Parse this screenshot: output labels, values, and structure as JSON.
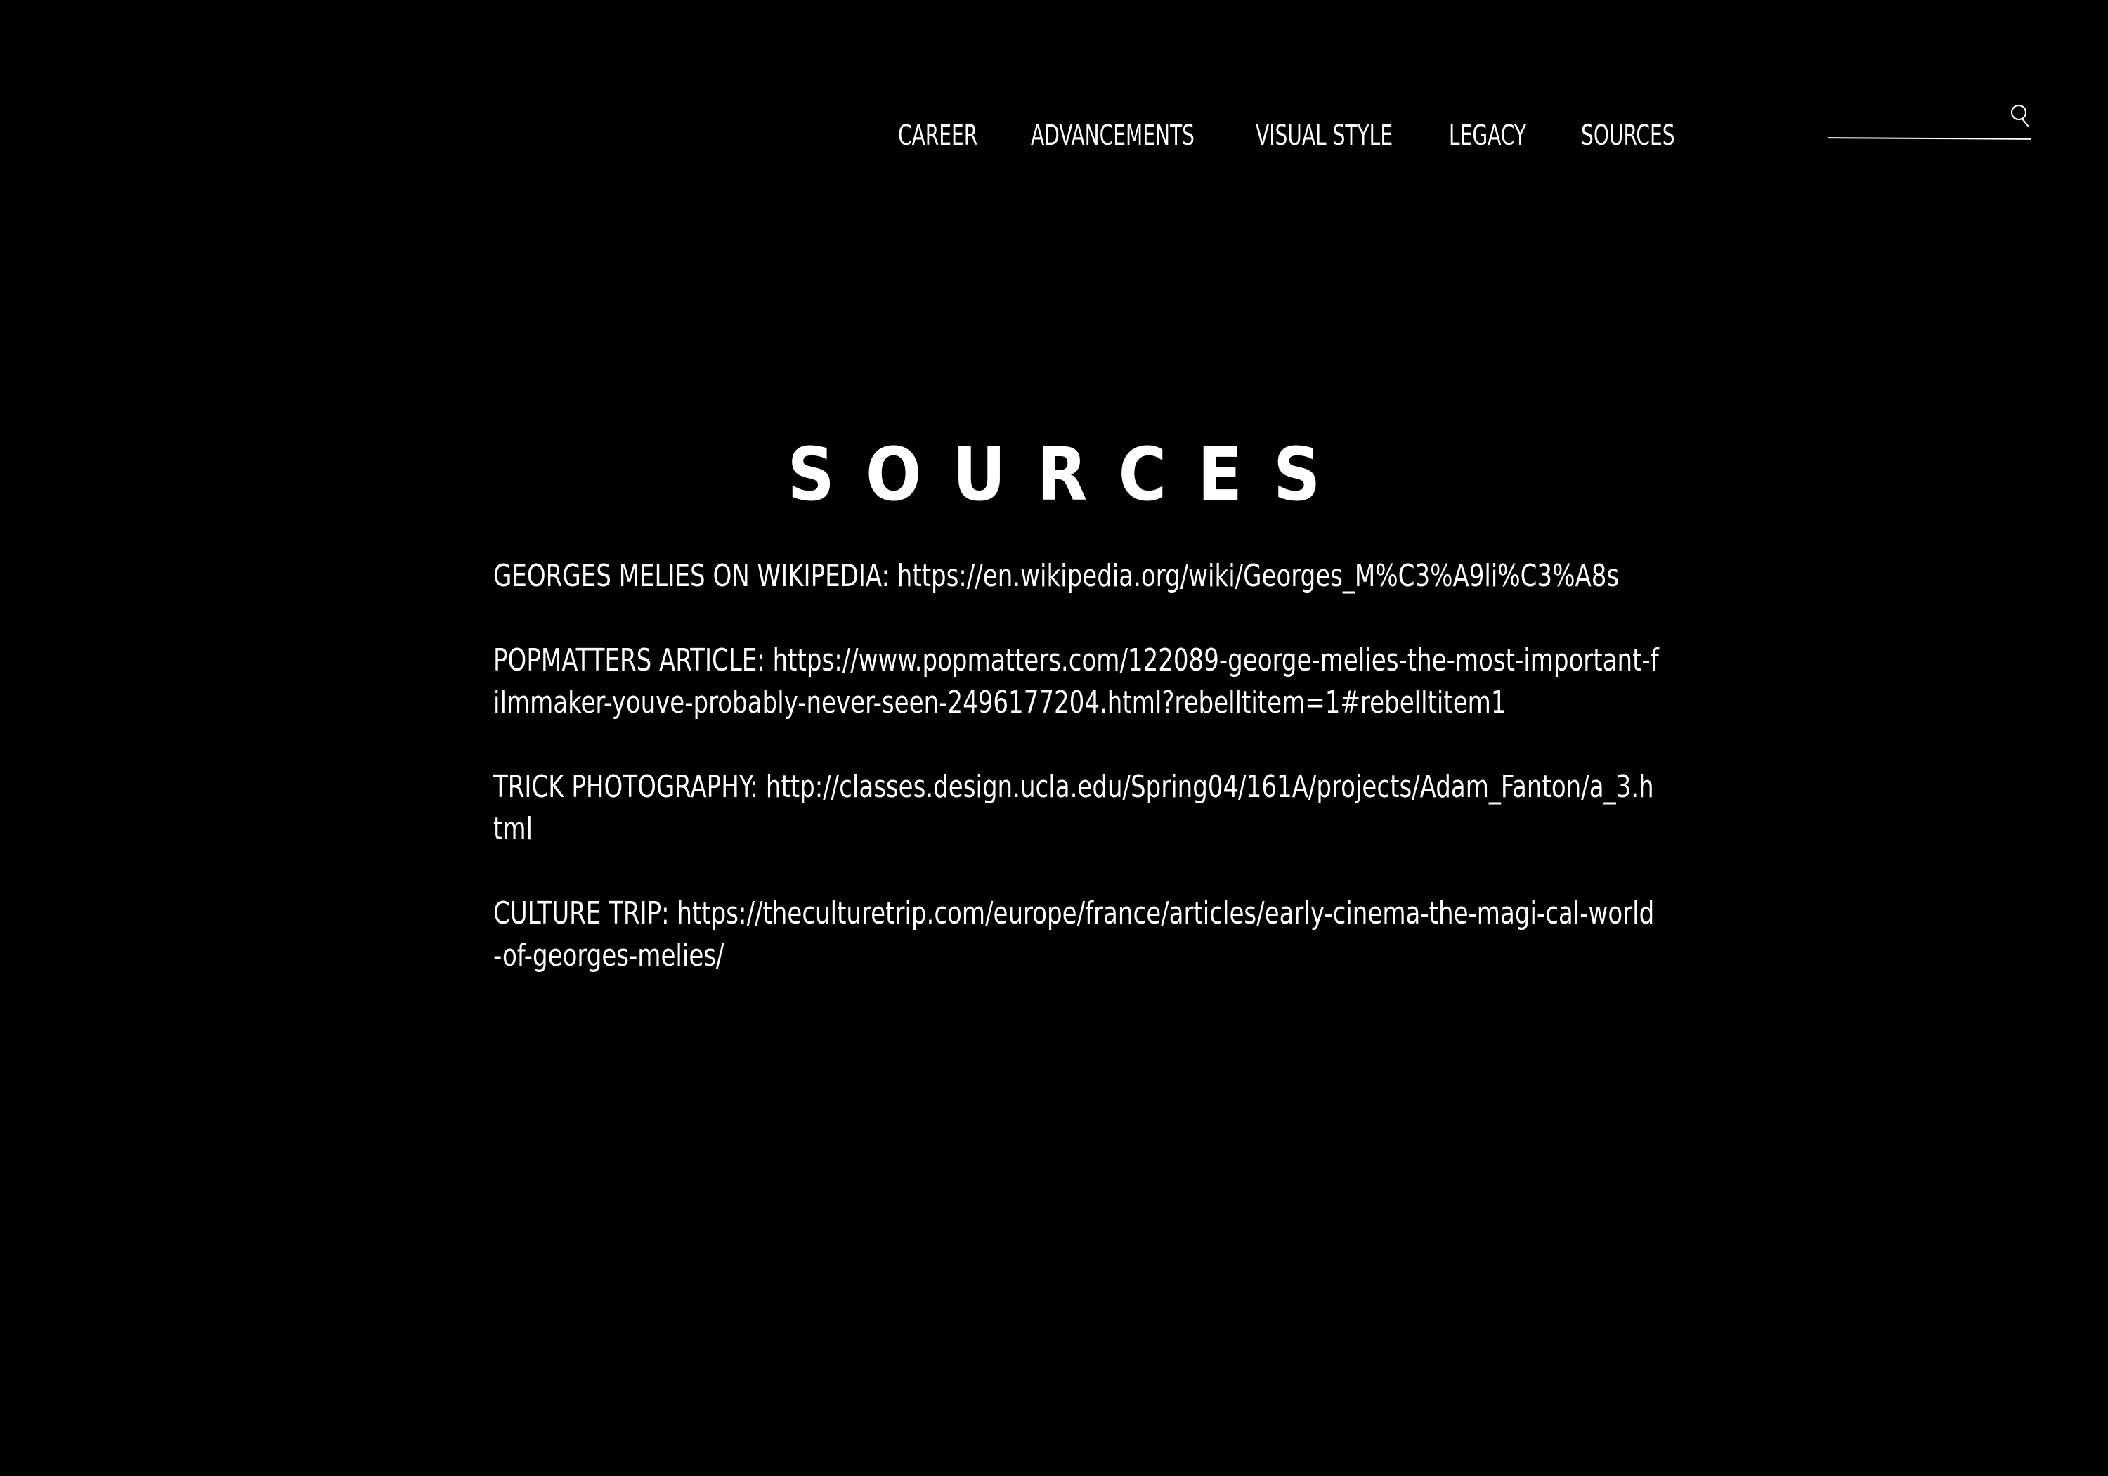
{
  "nav": {
    "items": [
      {
        "label": "CAREER"
      },
      {
        "label": "ADVANCEMENTS"
      },
      {
        "label": "VISUAL STYLE"
      },
      {
        "label": "LEGACY"
      },
      {
        "label": "SOURCES"
      }
    ]
  },
  "search": {
    "value": "",
    "icon": "search-icon"
  },
  "page": {
    "title": "SOURCES"
  },
  "sources": [
    {
      "label": "GEORGES MELIES ON WIKIPEDIA:",
      "url": "https://en.wikipedia.org/wiki/Georges_M%C3%A9li%C3%A8s"
    },
    {
      "label": "POPMATTERS ARTICLE:",
      "url": "https://www.popmatters.com/122089-george-melies-the-most-important-filmmaker-youve-probably-never-seen-2496177204.html?rebelltitem=1#rebelltitem1"
    },
    {
      "label": "TRICK PHOTOGRAPHY:",
      "url": "http://classes.design.ucla.edu/Spring04/161A/projects/Adam_Fanton/a_3.html"
    },
    {
      "label": "CULTURE TRIP:",
      "url": "https://theculturetrip.com/europe/france/articles/early-cinema-the-magi-cal-world-of-georges-melies/"
    }
  ],
  "colors": {
    "background": "#000000",
    "text": "#ffffff"
  }
}
